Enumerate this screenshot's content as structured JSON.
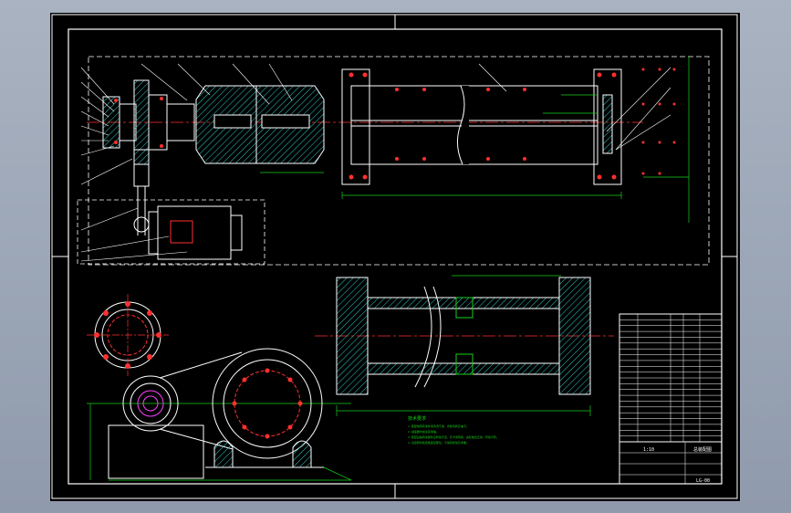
{
  "drawing": {
    "notes_title": "技术要求",
    "notes": [
      "1. 装配前所有零件须清洗干净，去除毛刺及油污。",
      "2. 减速器内加注润滑油。",
      "3. 装配后各转动部件应转动灵活，无卡滞现象，齿轮啮合正常，传动平稳。",
      "4. 试运转时检查各连接部位，不得有松动及渗漏。"
    ],
    "title_block": {
      "drawing_title": "总装配图",
      "company": "",
      "scale": "1:10",
      "drawing_no": "LG-00"
    },
    "parts_rows": 22
  },
  "colors": {
    "frame": "#ffffff",
    "part": "#ffffff",
    "dimension": "#18d018",
    "centerline": "#ff3030",
    "hatch": "#2ecbcb",
    "highlight": "#ff40ff",
    "bolt": "#ff3030"
  },
  "icons": [
    "flange-icon",
    "motor-icon",
    "bearing-icon",
    "coupling-icon"
  ]
}
